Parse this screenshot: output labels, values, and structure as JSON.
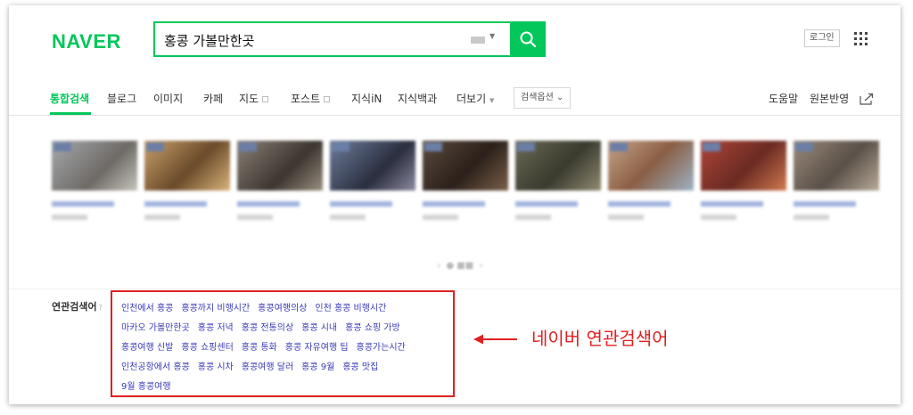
{
  "header": {
    "logo": "NAVER",
    "search_value": "홍콩 가볼만한곳",
    "login_label": "로그인"
  },
  "tabs": {
    "items": [
      {
        "label": "통합검색"
      },
      {
        "label": "블로그"
      },
      {
        "label": "이미지"
      },
      {
        "label": "카페"
      },
      {
        "label": "지도"
      },
      {
        "label": "포스트"
      },
      {
        "label": "지식iN"
      },
      {
        "label": "지식백과"
      },
      {
        "label": "더보기"
      }
    ],
    "options_label": "검색옵션",
    "right": [
      {
        "label": "도움말"
      },
      {
        "label": "원본반영"
      }
    ]
  },
  "related": {
    "label": "연관검색어",
    "rows": [
      [
        "인천에서 홍콩",
        "홍콩까지 비행시간",
        "홍콩여행의상",
        "인천 홍콩 비행시간"
      ],
      [
        "마카오 가볼만한곳",
        "홍콩 저녁",
        "홍콩 전통의상",
        "홍콩 시내",
        "홍콩 쇼핑 가방"
      ],
      [
        "홍콩여행 신발",
        "홍콩 쇼핑센터",
        "홍콩 통화",
        "홍콩 자유여행 팁",
        "홍콩가는시간"
      ],
      [
        "인천공항에서 홍콩",
        "홍콩 시차",
        "홍콩여행 달러",
        "홍콩 9월",
        "홍콩 맛집"
      ],
      [
        "9월 홍콩여행"
      ]
    ]
  },
  "annotation": "네이버 연관검색어",
  "colors": {
    "brand_green": "#03c75a",
    "link_blue": "#3a3ab8",
    "highlight_red": "#e02020"
  }
}
